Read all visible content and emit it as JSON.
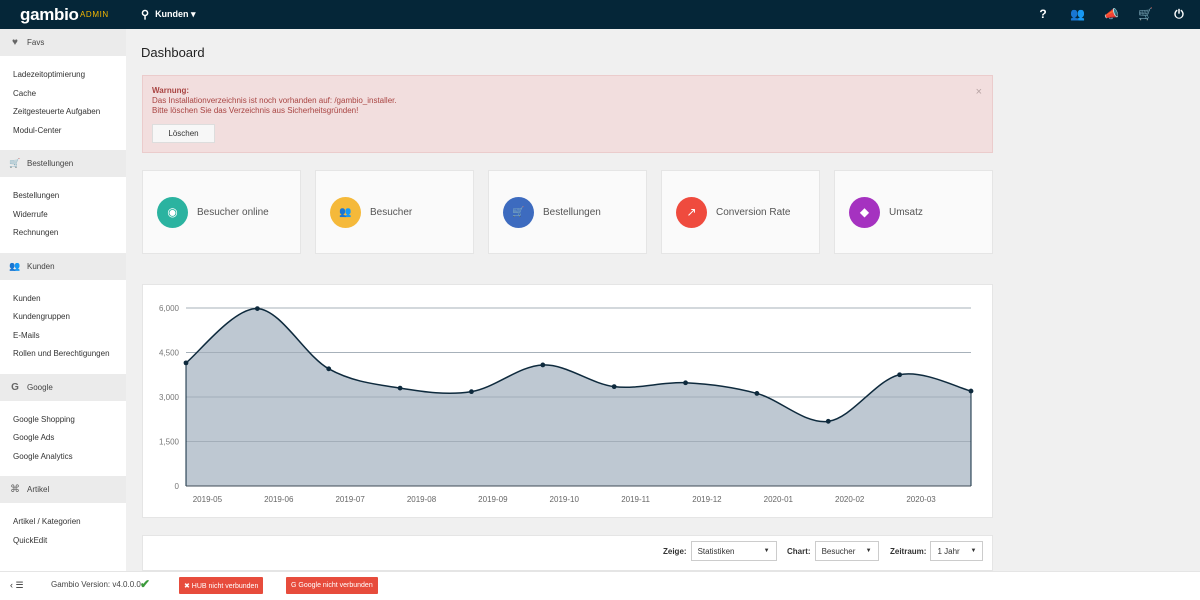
{
  "header": {
    "logo": "gambio",
    "admin": "ADMIN",
    "search_icon": "⚲",
    "search_scope": "Kunden ▾",
    "icons": [
      "?",
      "👥",
      "📣",
      "🛒",
      "⏻"
    ]
  },
  "sidebar": {
    "sections": [
      {
        "icon": "♥",
        "title": "Favs",
        "items": [
          "Ladezeitoptimierung",
          "Cache",
          "Zeitgesteuerte Aufgaben",
          "Modul-Center"
        ]
      },
      {
        "icon": "🛒",
        "title": "Bestellungen",
        "items": [
          "Bestellungen",
          "Widerrufe",
          "Rechnungen"
        ]
      },
      {
        "icon": "👥",
        "title": "Kunden",
        "items": [
          "Kunden",
          "Kundengruppen",
          "E-Mails",
          "Rollen und Berechtigungen"
        ]
      },
      {
        "icon": "G",
        "title": "Google",
        "items": [
          "Google Shopping",
          "Google Ads",
          "Google Analytics"
        ]
      },
      {
        "icon": "⌘",
        "title": "Artikel",
        "items": [
          "Artikel / Kategorien",
          "QuickEdit"
        ]
      }
    ]
  },
  "main": {
    "title": "Dashboard",
    "alert": {
      "heading": "Warnung:",
      "line1": "Das Installationverzeichnis ist noch vorhanden auf: /gambio_installer.",
      "line2": "Bitte löschen Sie das Verzeichnis aus Sicherheitsgründen!",
      "close": "×",
      "button": "Löschen"
    },
    "stats": [
      {
        "label": "Besucher online",
        "color": "#2bb3a0",
        "icon": "◉"
      },
      {
        "label": "Besucher",
        "color": "#f5b93a",
        "icon": "👥"
      },
      {
        "label": "Bestellungen",
        "color": "#3d6bbf",
        "icon": "🛒"
      },
      {
        "label": "Conversion Rate",
        "color": "#ef4b3e",
        "icon": "↗"
      },
      {
        "label": "Umsatz",
        "color": "#a532c0",
        "icon": "◆"
      }
    ],
    "filters": {
      "zeige_label": "Zeige:",
      "zeige_value": "Statistiken",
      "chart_label": "Chart:",
      "chart_value": "Besucher",
      "zeitraum_label": "Zeitraum:",
      "zeitraum_value": "1 Jahr"
    }
  },
  "chart_data": {
    "type": "area",
    "x": [
      "2019-05",
      "2019-06",
      "2019-07",
      "2019-08",
      "2019-09",
      "2019-10",
      "2019-11",
      "2019-12",
      "2020-01",
      "2020-02",
      "2020-03",
      "2020-04"
    ],
    "x_tick_labels": [
      "2019-05",
      "2019-06",
      "2019-07",
      "2019-08",
      "2019-09",
      "2019-10",
      "2019-11",
      "2019-12",
      "2020-01",
      "2020-02",
      "2020-03"
    ],
    "values": [
      4150,
      5980,
      3950,
      3300,
      3180,
      4080,
      3350,
      3480,
      3120,
      2180,
      3750,
      3200
    ],
    "y_ticks": [
      "0",
      "1,500",
      "3,000",
      "4,500",
      "6,000"
    ],
    "ylim": [
      0,
      6000
    ],
    "grid": true,
    "fill_color": "#bec8d2",
    "line_color": "#0e2a3d"
  },
  "footer": {
    "toggle": "‹ ☰",
    "version": "Gambio Version: v4.0.0.0",
    "check": "✔",
    "hub": "✖ HUB nicht verbunden",
    "google": "G Google nicht verbunden"
  }
}
